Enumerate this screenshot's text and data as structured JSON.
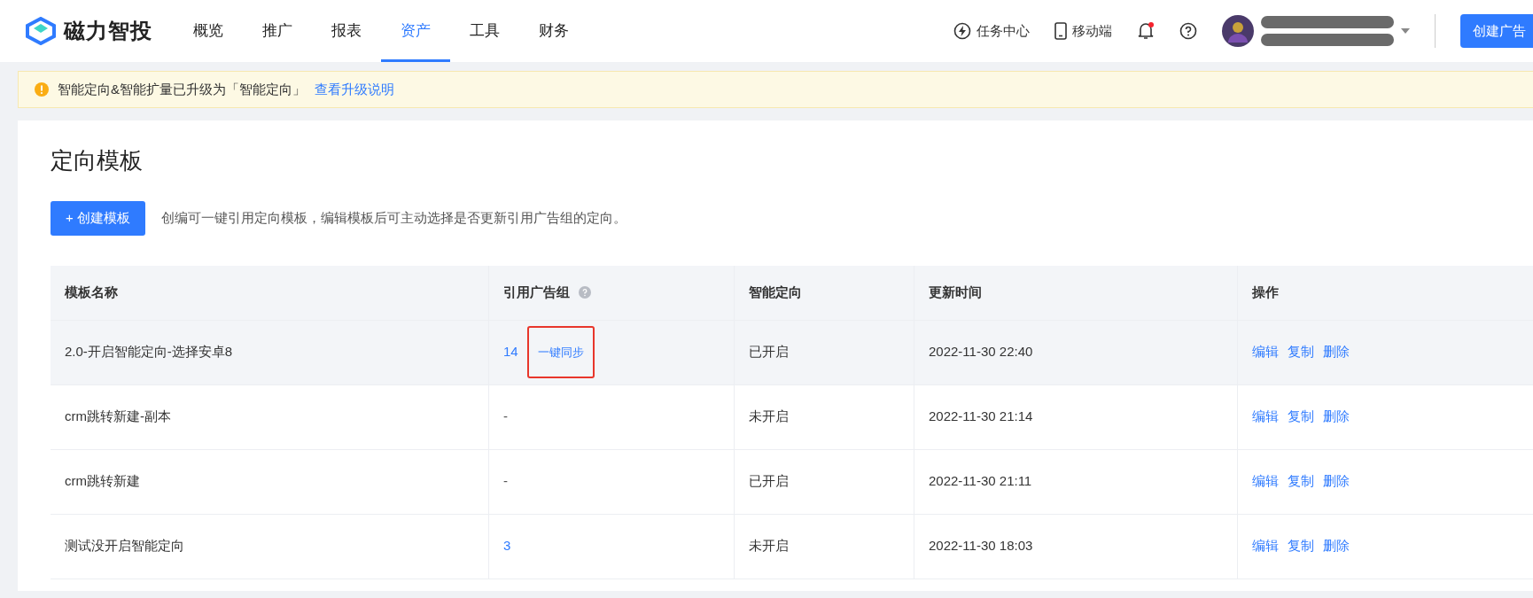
{
  "header": {
    "brand": "磁力智投",
    "nav": [
      {
        "label": "概览",
        "selected": false
      },
      {
        "label": "推广",
        "selected": false
      },
      {
        "label": "报表",
        "selected": false
      },
      {
        "label": "资产",
        "selected": true
      },
      {
        "label": "工具",
        "selected": false
      },
      {
        "label": "财务",
        "selected": false
      }
    ],
    "task_center": "任务中心",
    "mobile": "移动端",
    "notification_unread": true,
    "create_button": "创建广告"
  },
  "alert": {
    "message": "智能定向&智能扩量已升级为「智能定向」",
    "link": "查看升级说明"
  },
  "page": {
    "title": "定向模板",
    "create_button": "+ 创建模板",
    "hint": "创编可一键引用定向模板，编辑模板后可主动选择是否更新引用广告组的定向。"
  },
  "table": {
    "columns": [
      {
        "label": "模板名称"
      },
      {
        "label": "引用广告组",
        "help": true
      },
      {
        "label": "智能定向"
      },
      {
        "label": "更新时间"
      },
      {
        "label": "操作"
      }
    ],
    "rows": [
      {
        "name": "2.0-开启智能定向-选择安卓8",
        "ref_count": "14",
        "ref_linked": true,
        "sync": "一键同步",
        "sync_annotated": true,
        "smart": "已开启",
        "updated": "2022-11-30 22:40",
        "hovered": true,
        "actions": [
          "编辑",
          "复制",
          "删除"
        ]
      },
      {
        "name": "crm跳转新建-副本",
        "ref_count": "-",
        "ref_linked": false,
        "smart": "未开启",
        "updated": "2022-11-30 21:14",
        "hovered": false,
        "actions": [
          "编辑",
          "复制",
          "删除"
        ]
      },
      {
        "name": "crm跳转新建",
        "ref_count": "-",
        "ref_linked": false,
        "smart": "已开启",
        "updated": "2022-11-30 21:11",
        "hovered": false,
        "actions": [
          "编辑",
          "复制",
          "删除"
        ]
      },
      {
        "name": "测试没开启智能定向",
        "ref_count": "3",
        "ref_linked": true,
        "smart": "未开启",
        "updated": "2022-11-30 18:03",
        "hovered": false,
        "actions": [
          "编辑",
          "复制",
          "删除"
        ]
      }
    ]
  }
}
